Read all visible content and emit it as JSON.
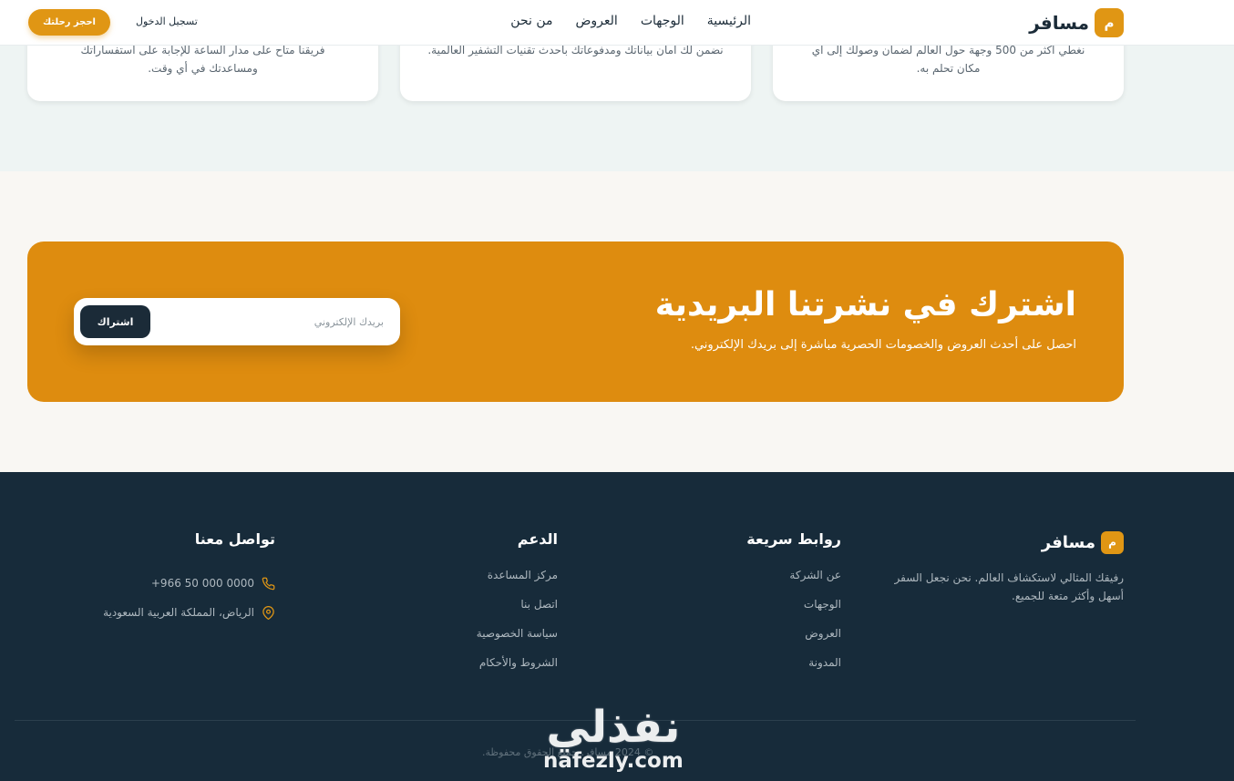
{
  "nav": {
    "logo_letter": "م",
    "logo_text": "مسافر",
    "links": [
      "الرئيسية",
      "الوجهات",
      "العروض",
      "من نحن"
    ],
    "login": "تسجيل الدخول",
    "book": "احجز رحلتك"
  },
  "cards": [
    {
      "text": "نغطي أكثر من 500 وجهة حول العالم لضمان وصولك إلى أي مكان تحلم به."
    },
    {
      "text": "نضمن لك أمان بياناتك ومدفوعاتك بأحدث تقنيات التشفير العالمية."
    },
    {
      "text": "فريقنا متاح على مدار الساعة للإجابة على استفساراتك ومساعدتك في أي وقت."
    }
  ],
  "newsletter": {
    "title": "اشترك في نشرتنا البريدية",
    "subtitle": "احصل على أحدث العروض والخصومات الحصرية مباشرة إلى بريدك الإلكتروني.",
    "placeholder": "بريدك الإلكتروني",
    "button": "اشتراك"
  },
  "footer": {
    "brand_letter": "م",
    "brand_name": "مسافر",
    "description": "رفيقك المثالي لاستكشاف العالم. نحن نجعل السفر أسهل وأكثر متعة للجميع.",
    "quick_title": "روابط سريعة",
    "quick_links": [
      "عن الشركة",
      "الوجهات",
      "العروض",
      "المدونة"
    ],
    "support_title": "الدعم",
    "support_links": [
      "مركز المساعدة",
      "اتصل بنا",
      "سياسة الخصوصية",
      "الشروط والأحكام"
    ],
    "contact_title": "تواصل معنا",
    "phone": "+966 50 000 0000",
    "address": "الرياض، المملكة العربية السعودية",
    "copyright": "© 2024 مسافر. جميع الحقوق محفوظة."
  },
  "watermark": {
    "arabic": "نفذلي",
    "latin": "nafezly.com"
  },
  "colors": {
    "accent": "#e09614",
    "dark": "#172b3a",
    "banner": "#de8c0f"
  }
}
